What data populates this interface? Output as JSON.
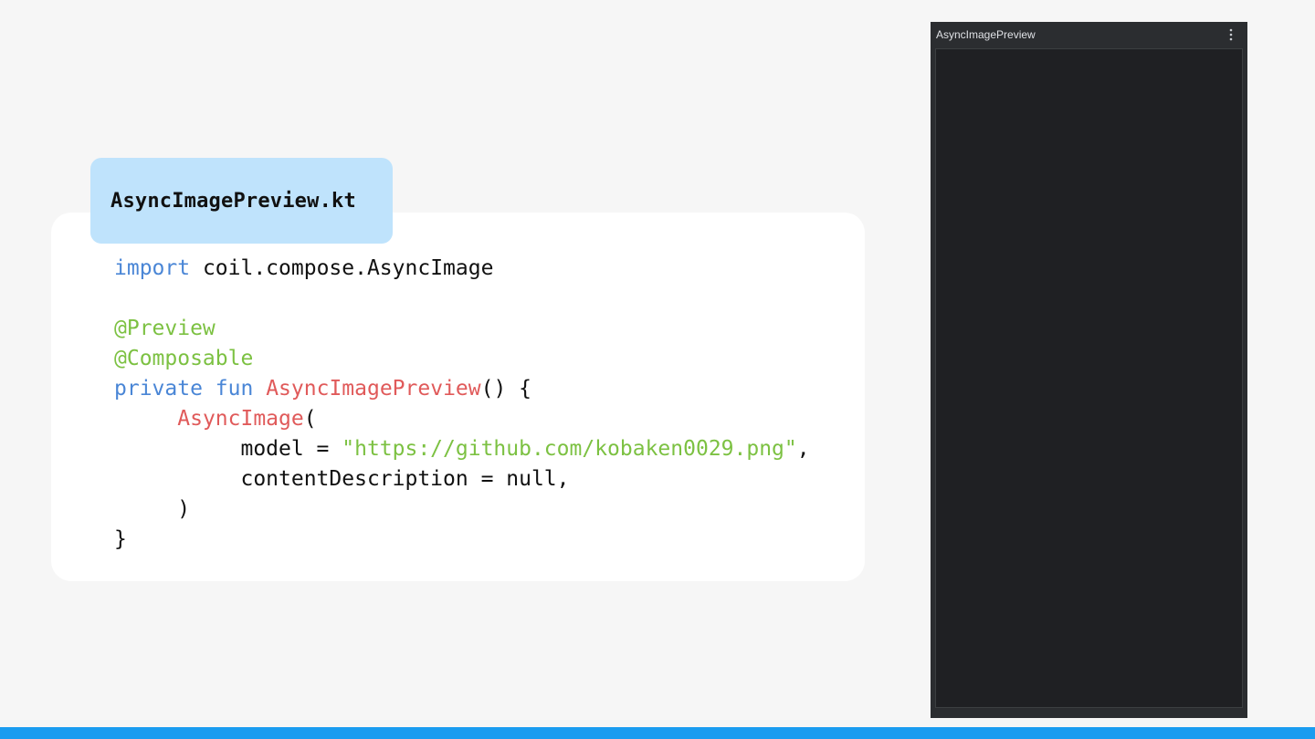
{
  "file_tab": {
    "filename": "AsyncImagePreview.kt"
  },
  "code": {
    "lines": [
      [
        {
          "t": "import",
          "k": "kw"
        },
        {
          "t": " coil.compose.AsyncImage",
          "k": "plain"
        }
      ],
      [],
      [
        {
          "t": "@Preview",
          "k": "ann"
        }
      ],
      [
        {
          "t": "@Composable",
          "k": "ann"
        }
      ],
      [
        {
          "t": "private",
          "k": "kw"
        },
        {
          "t": " ",
          "k": "plain"
        },
        {
          "t": "fun",
          "k": "kw"
        },
        {
          "t": " ",
          "k": "plain"
        },
        {
          "t": "AsyncImagePreview",
          "k": "fn"
        },
        {
          "t": "() {",
          "k": "plain"
        }
      ],
      [
        {
          "t": "     ",
          "k": "plain"
        },
        {
          "t": "AsyncImage",
          "k": "fn"
        },
        {
          "t": "(",
          "k": "plain"
        }
      ],
      [
        {
          "t": "          model = ",
          "k": "plain"
        },
        {
          "t": "\"https://github.com/kobaken0029.png\"",
          "k": "str"
        },
        {
          "t": ",",
          "k": "plain"
        }
      ],
      [
        {
          "t": "          contentDescription = null,",
          "k": "plain"
        }
      ],
      [
        {
          "t": "     )",
          "k": "plain"
        }
      ],
      [
        {
          "t": "}",
          "k": "plain"
        }
      ]
    ]
  },
  "preview_panel": {
    "title": "AsyncImagePreview",
    "menu_icon": "more-vertical-icon"
  },
  "colors": {
    "keyword": "#4a86d6",
    "annotation": "#7cc142",
    "function": "#e05a5a",
    "string": "#7cc142",
    "accent_bar": "#1a9cf0",
    "tab_background": "#bfe3fc"
  }
}
